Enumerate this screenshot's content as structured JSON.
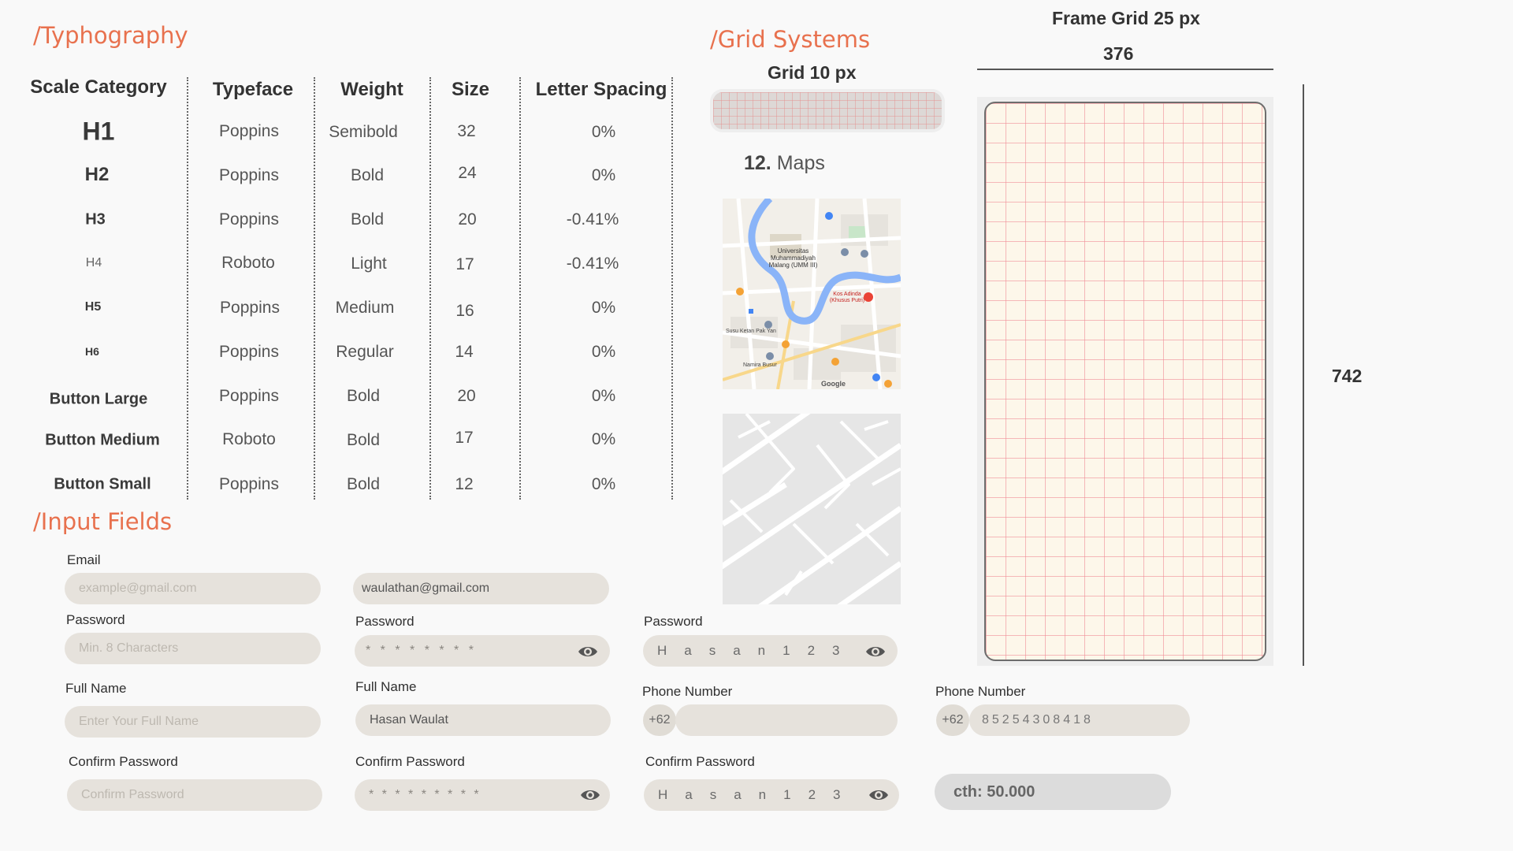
{
  "typography": {
    "title": "/Typhography",
    "headers": [
      "Scale Category",
      "Typeface",
      "Weight",
      "Size",
      "Letter Spacing"
    ],
    "rows": [
      {
        "category": "H1",
        "typeface": "Poppins",
        "weight": "Semibold",
        "size": "32",
        "spacing": "0%"
      },
      {
        "category": "H2",
        "typeface": "Poppins",
        "weight": "Bold",
        "size": "24",
        "spacing": "0%"
      },
      {
        "category": "H3",
        "typeface": "Poppins",
        "weight": "Bold",
        "size": "20",
        "spacing": "-0.41%"
      },
      {
        "category": "H4",
        "typeface": "Roboto",
        "weight": "Light",
        "size": "17",
        "spacing": "-0.41%"
      },
      {
        "category": "H5",
        "typeface": "Poppins",
        "weight": "Medium",
        "size": "16",
        "spacing": "0%"
      },
      {
        "category": "H6",
        "typeface": "Poppins",
        "weight": "Regular",
        "size": "14",
        "spacing": "0%"
      },
      {
        "category": "Button Large",
        "typeface": "Poppins",
        "weight": "Bold",
        "size": "20",
        "spacing": "0%"
      },
      {
        "category": "Button Medium",
        "typeface": "Roboto",
        "weight": "Bold",
        "size": "17",
        "spacing": "0%"
      },
      {
        "category": "Button Small",
        "typeface": "Poppins",
        "weight": "Bold",
        "size": "12",
        "spacing": "0%"
      }
    ]
  },
  "grid": {
    "title": "/Grid Systems",
    "grid10_label": "Grid 10 px",
    "frame_label": "Frame Grid 25 px",
    "frame_width": "376",
    "frame_height": "742"
  },
  "maps": {
    "number": "12.",
    "label": "Maps",
    "places": [
      "Universitas Muhammadiyah Malang (UMM III)",
      "Kos Adinda (Khusus Putri)",
      "Susu Ketan Pak Yan",
      "Namira Busur",
      "Google"
    ]
  },
  "inputs": {
    "title": "/Input Fields",
    "col1": {
      "email_label": "Email",
      "email_placeholder": "example@gmail.com",
      "password_label": "Password",
      "password_placeholder": "Min. 8 Characters",
      "fullname_label": "Full Name",
      "fullname_placeholder": "Enter Your Full Name",
      "confirm_label": "Confirm Password",
      "confirm_placeholder": "Confirm Password"
    },
    "col2": {
      "email_value": "waulathan@gmail.com",
      "password_label": "Password",
      "password_value": "* * * * * * * *",
      "fullname_label": "Full Name",
      "fullname_value": "Hasan Waulat",
      "confirm_label": "Confirm Password",
      "confirm_value": "* * * * * * * * *"
    },
    "col3": {
      "password_label": "Password",
      "password_value": "Hasan123",
      "phone_label": "Phone Number",
      "phone_prefix": "+62",
      "phone_value": "",
      "confirm_label": "Confirm Password",
      "confirm_value": "Hasan123"
    },
    "col4": {
      "phone_label": "Phone Number",
      "phone_prefix": "+62",
      "phone_value": "85254308418",
      "amount_value": "cth: 50.000"
    }
  },
  "colors": {
    "accent": "#e8714e",
    "field_bg": "#e6e2dc",
    "grid_line": "#f08c96"
  }
}
